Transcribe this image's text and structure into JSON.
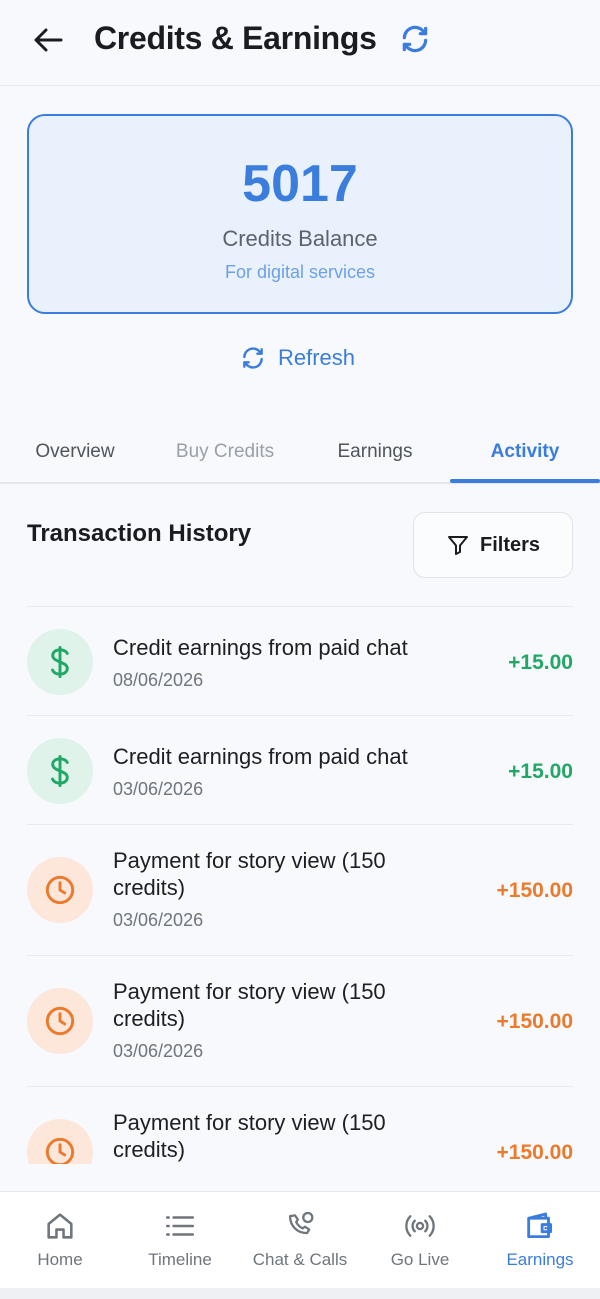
{
  "header": {
    "title": "Credits & Earnings",
    "back_icon": "arrow-left-icon",
    "refresh_icon": "refresh-icon"
  },
  "balance": {
    "value": "5017",
    "label": "Credits Balance",
    "subtitle": "For digital services"
  },
  "refresh_link": {
    "label": "Refresh"
  },
  "tabs": [
    {
      "label": "Overview"
    },
    {
      "label": "Buy Credits"
    },
    {
      "label": "Earnings"
    },
    {
      "label": "Activity",
      "active": true
    }
  ],
  "history": {
    "title": "Transaction History",
    "filters_label": "Filters"
  },
  "transactions": [
    {
      "icon": "dollar-icon",
      "title": "Credit earnings from paid chat",
      "date": "08/06/2026",
      "amount": "+15.00",
      "kind": "green"
    },
    {
      "icon": "dollar-icon",
      "title": "Credit earnings from paid chat",
      "date": "03/06/2026",
      "amount": "+15.00",
      "kind": "green"
    },
    {
      "icon": "clock-icon",
      "title": "Payment for story view (150 credits)",
      "date": "03/06/2026",
      "amount": "+150.00",
      "kind": "orange"
    },
    {
      "icon": "clock-icon",
      "title": "Payment for story view (150 credits)",
      "date": "03/06/2026",
      "amount": "+150.00",
      "kind": "orange"
    },
    {
      "icon": "clock-icon",
      "title": "Payment for story view (150 credits)",
      "date": "",
      "amount": "+150.00",
      "kind": "orange"
    }
  ],
  "bottom_nav": [
    {
      "label": "Home",
      "icon": "home-icon"
    },
    {
      "label": "Timeline",
      "icon": "list-icon"
    },
    {
      "label": "Chat & Calls",
      "icon": "phone-chat-icon"
    },
    {
      "label": "Go Live",
      "icon": "broadcast-icon"
    },
    {
      "label": "Earnings",
      "icon": "wallet-icon",
      "active": true
    }
  ],
  "colors": {
    "accent": "#3b7ddd",
    "positive": "#22a866",
    "warning": "#ec7a2c"
  }
}
